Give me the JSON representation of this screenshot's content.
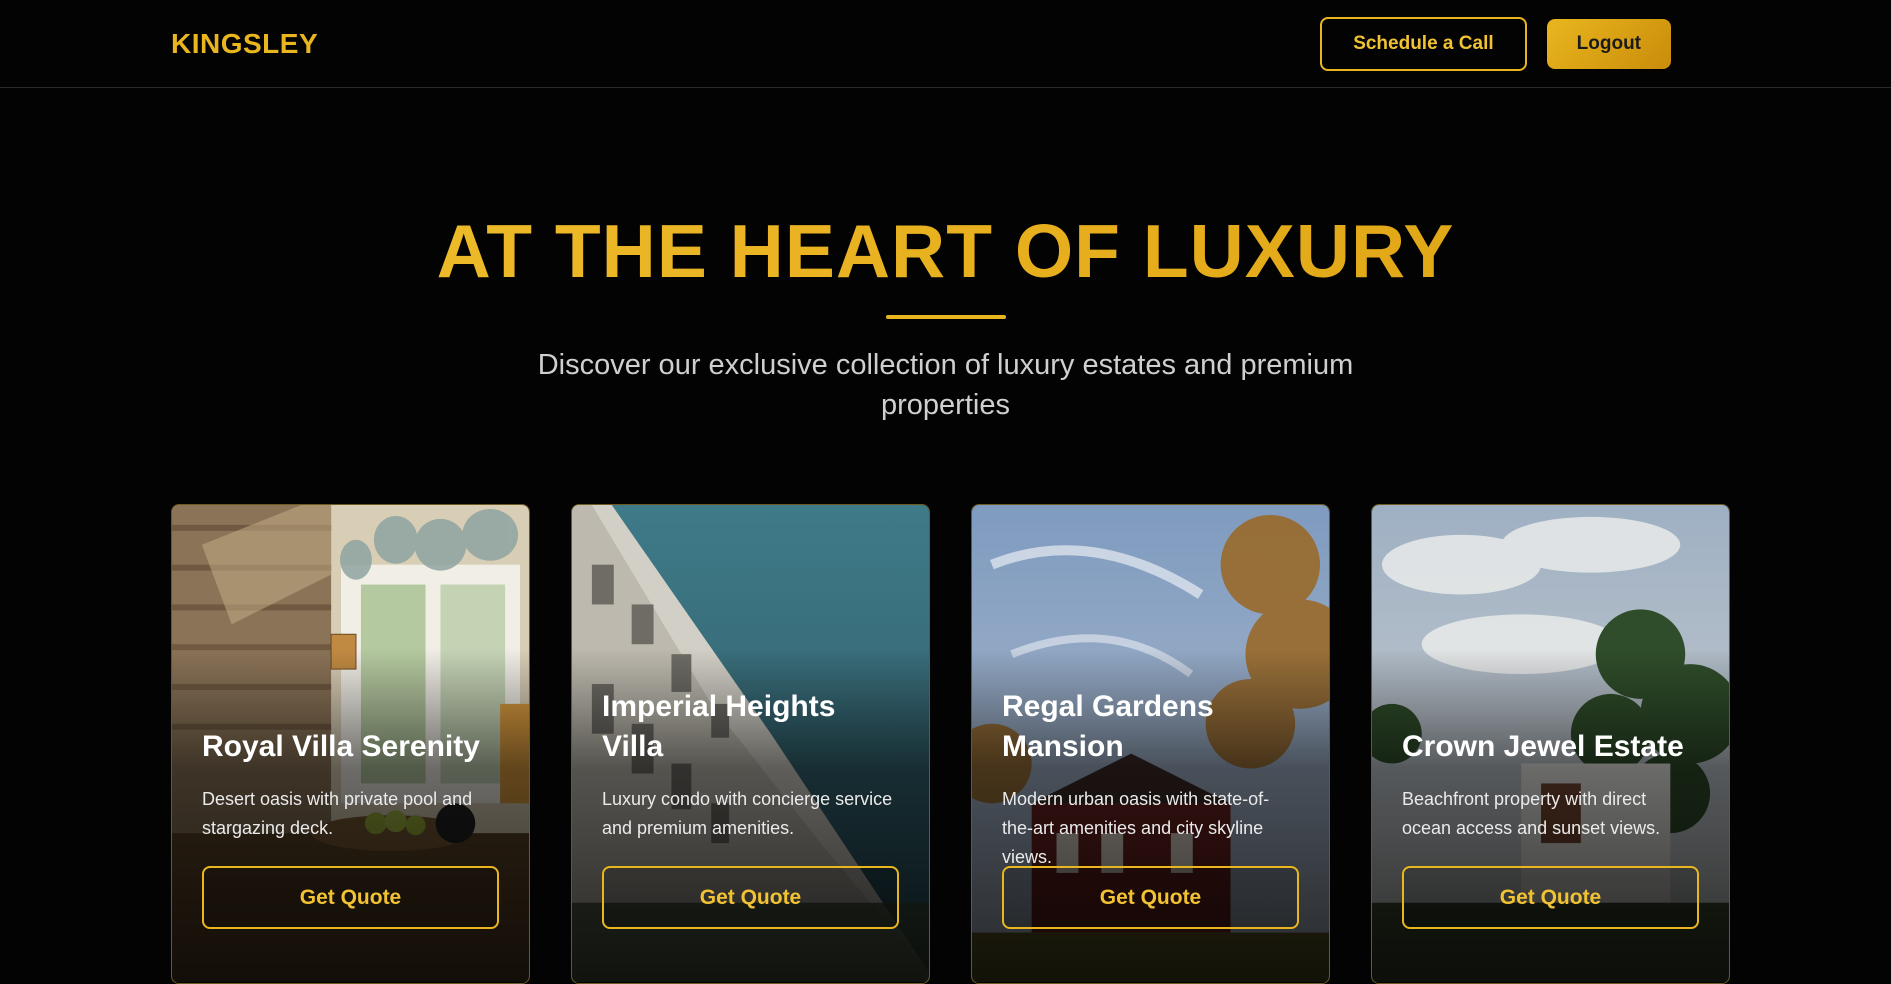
{
  "nav": {
    "logo": "KINGSLEY",
    "schedule_label": "Schedule a Call",
    "logout_label": "Logout"
  },
  "hero": {
    "title": "AT THE HEART OF LUXURY",
    "subtitle": "Discover our exclusive collection of luxury estates and premium properties"
  },
  "cards": [
    {
      "title": "Royal Villa Serenity",
      "description": "Desert oasis with private pool and stargazing deck.",
      "cta": "Get Quote"
    },
    {
      "title": "Imperial Heights Villa",
      "description": "Luxury condo with concierge service and premium amenities.",
      "cta": "Get Quote"
    },
    {
      "title": "Regal Gardens Mansion",
      "description": "Modern urban oasis with state-of-the-art amenities and city skyline views.",
      "cta": "Get Quote"
    },
    {
      "title": "Crown Jewel Estate",
      "description": "Beachfront property with direct ocean access and sunset views.",
      "cta": "Get Quote"
    }
  ],
  "colors": {
    "accent": "#e9b61f",
    "background": "#030303"
  }
}
